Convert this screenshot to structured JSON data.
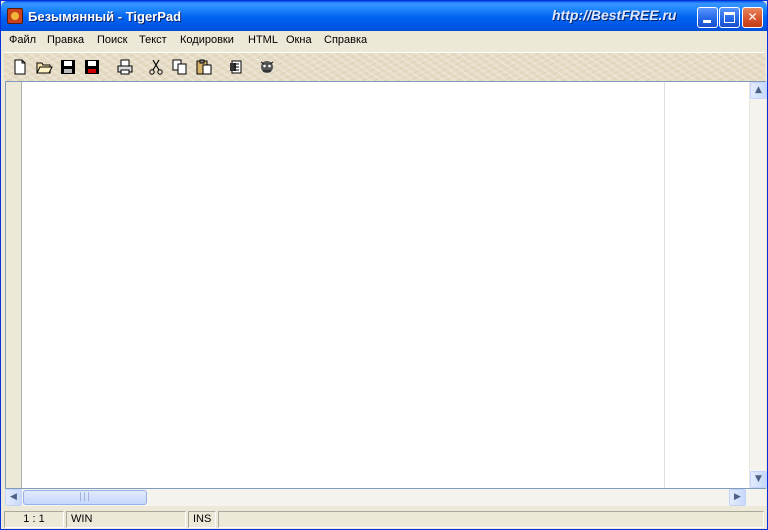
{
  "window": {
    "title": "Безымянный - TigerPad",
    "watermark": "http://BestFREE.ru",
    "controls": {
      "minimize": "minimize",
      "maximize": "maximize",
      "close": "✕"
    }
  },
  "menu": {
    "items": [
      "Файл",
      "Правка",
      "Поиск",
      "Текст",
      "Кодировки",
      "HTML",
      "Окна",
      "Справка"
    ]
  },
  "toolbar": {
    "buttons": [
      "new-file-icon",
      "open-folder-icon",
      "save-icon",
      "save-all-icon",
      "print-icon",
      "cut-icon",
      "copy-icon",
      "paste-icon",
      "bookmark-icon",
      "tiger-icon"
    ]
  },
  "scrollbar": {
    "up": "▲",
    "down": "▼",
    "left": "◀",
    "right": "▶",
    "grip": "|||"
  },
  "status": {
    "position": "1 : 1",
    "encoding": "WIN",
    "mode": "INS"
  },
  "colors": {
    "titlebar": "#0058ee",
    "close_button": "#d4512b",
    "toolbar_bg": "#e6dcc5",
    "window_bg": "#ece9d8"
  }
}
